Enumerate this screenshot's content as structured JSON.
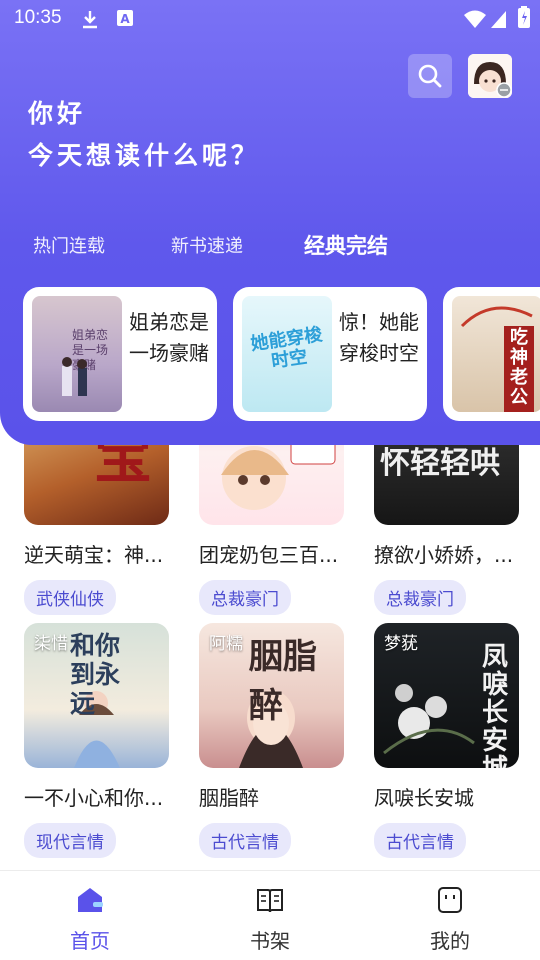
{
  "status_bar": {
    "time": "10:35"
  },
  "header": {
    "greeting_line1": "你好",
    "greeting_line2": "今天想读什么呢？",
    "tabs": [
      {
        "label": "热门连载",
        "active": false
      },
      {
        "label": "新书速递",
        "active": false
      },
      {
        "label": "经典完结",
        "active": true
      }
    ]
  },
  "featured": [
    {
      "title": "姐弟恋是一场豪赌",
      "cover_text": "姐弟恋是一场豪赌"
    },
    {
      "title": "惊！她能穿梭时空",
      "cover_text": "她能穿梭时空"
    },
    {
      "title": "",
      "cover_text": "吃神老公"
    }
  ],
  "books": [
    {
      "title": "逆天萌宝：神...",
      "tag": "武侠仙侠",
      "author": "",
      "cover_text": "宝"
    },
    {
      "title": "团宠奶包三百...",
      "tag": "总裁豪门",
      "author": "",
      "cover_text": ""
    },
    {
      "title": "撩欲小娇娇，...",
      "tag": "总裁豪门",
      "author": "",
      "cover_text": "被厉爷抱怀轻轻哄"
    },
    {
      "title": "一不小心和你...",
      "tag": "现代言情",
      "author": "柒惜",
      "cover_text": "和你到永远"
    },
    {
      "title": "胭脂醉",
      "tag": "古代言情",
      "author": "阿糯",
      "cover_text": "胭脂醉"
    },
    {
      "title": "凤唳长安城",
      "tag": "古代言情",
      "author": "梦莸",
      "cover_text": "凤唳长安城"
    }
  ],
  "nav": [
    {
      "label": "首页",
      "active": true
    },
    {
      "label": "书架",
      "active": false
    },
    {
      "label": "我的",
      "active": false
    }
  ],
  "colors": {
    "accent": "#5a52ea",
    "tag_bg": "#e8e8fb",
    "tag_text": "#4b4bd0"
  }
}
